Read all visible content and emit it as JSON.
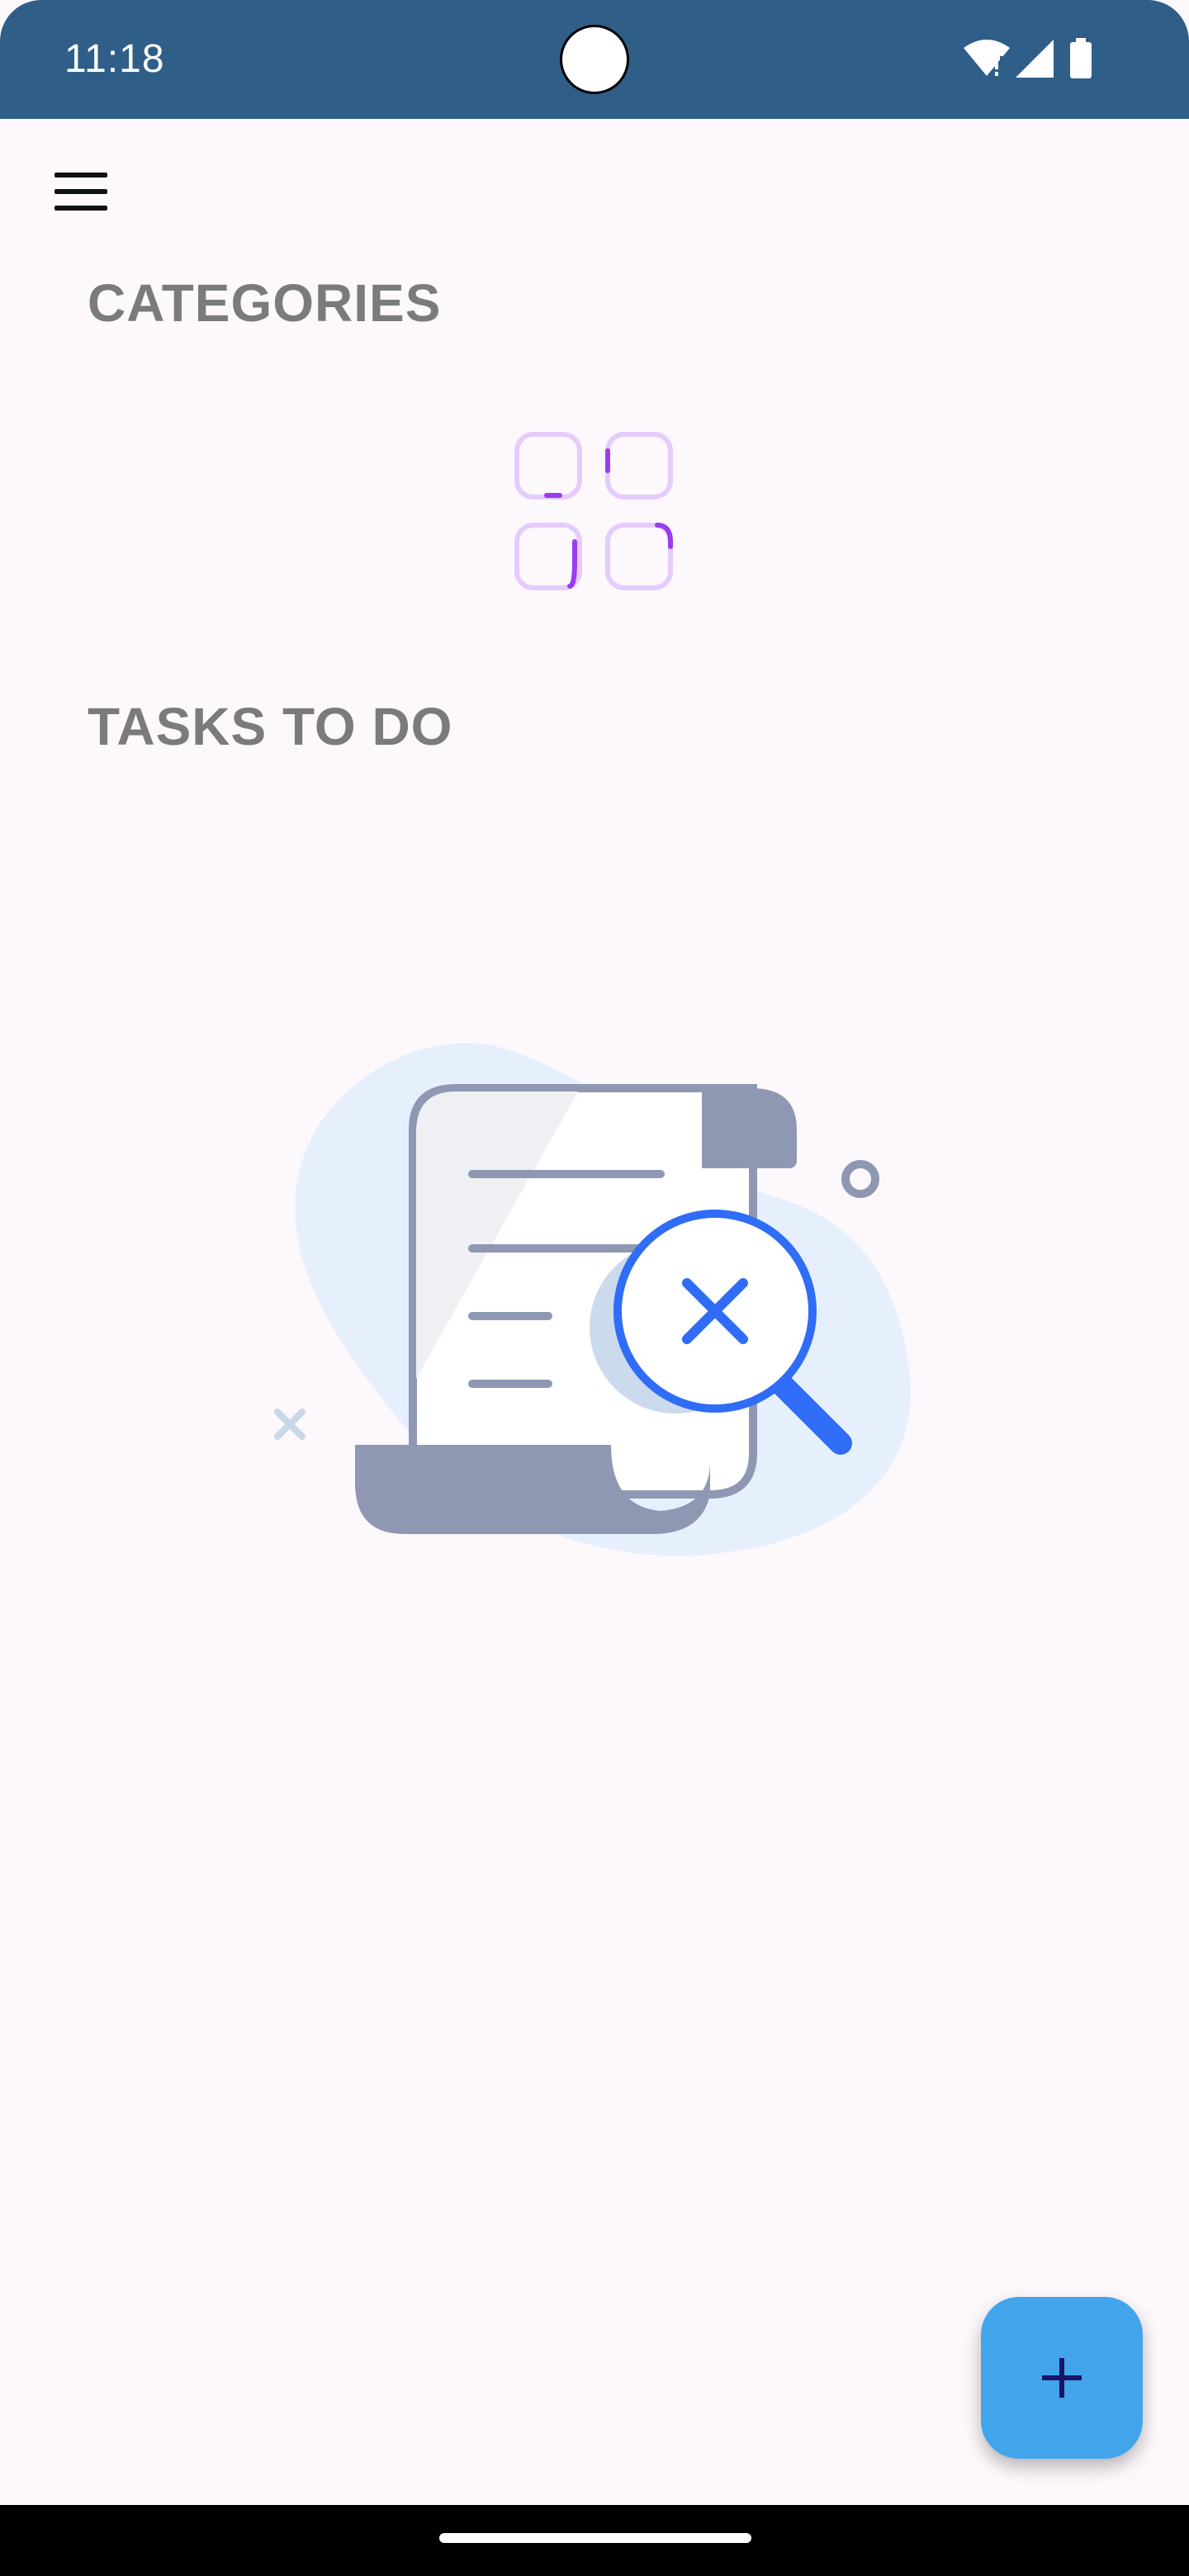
{
  "status_bar": {
    "time": "11:18",
    "icons": [
      "wifi-alert-icon",
      "signal-icon",
      "battery-icon"
    ],
    "color": "#2f5f88"
  },
  "toolbar": {
    "menu_icon": "hamburger-menu-icon"
  },
  "sections": {
    "categories_title": "CATEGORIES",
    "tasks_title": "TASKS TO DO"
  },
  "categories_empty_icon": "categories-grid-icon",
  "tasks_empty_illustration": "empty-tasks-scroll-magnifier-illustration",
  "fab": {
    "icon": "plus-icon",
    "color": "#42a5ec"
  },
  "colors": {
    "background": "#fdf8fc",
    "accent_purple": "#9b3cf0",
    "illustration_blue": "#2f6df6"
  }
}
